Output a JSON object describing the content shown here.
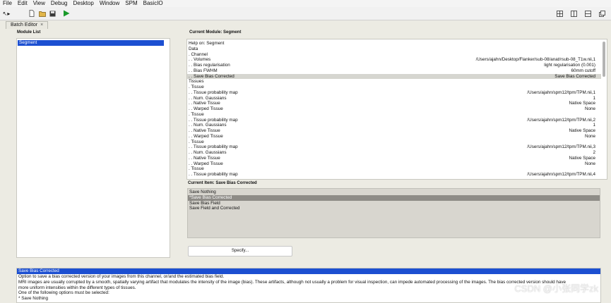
{
  "menubar": [
    "File",
    "Edit",
    "View",
    "Debug",
    "Desktop",
    "Window",
    "SPM",
    "BasicIO"
  ],
  "toolbar": {
    "undo_redo": "↖▸",
    "new_icon": "new-file-icon",
    "open_icon": "open-folder-icon",
    "save_icon": "save-icon",
    "run_icon": "run-icon"
  },
  "tab": {
    "label": "Batch Editor",
    "close": "×"
  },
  "module_list": {
    "heading": "Module List",
    "items": [
      "Segment"
    ]
  },
  "current_module": {
    "heading": "Current Module: Segment",
    "rows": [
      {
        "label": "Help on: Segment",
        "value": ""
      },
      {
        "label": "Data",
        "value": ""
      },
      {
        "label": ". Channel",
        "value": ""
      },
      {
        "label": ". . Volumes",
        "value": "/Users/ajahn/Desktop/Flanker/sub-08/anat/rsub-08_T1w.nii,1"
      },
      {
        "label": ". . Bias regularisation",
        "value": "light regularisation (0.001)"
      },
      {
        "label": ". . Bias FWHM",
        "value": "60mm cutoff"
      },
      {
        "label": ". . Save Bias Corrected",
        "value": "Save Bias Corrected"
      },
      {
        "label": "Tissues",
        "value": ""
      },
      {
        "label": ". Tissue",
        "value": ""
      },
      {
        "label": ". . Tissue probability map",
        "value": "/Users/ajahn/spm12/tpm/TPM.nii,1"
      },
      {
        "label": ". . Num. Gaussians",
        "value": "1"
      },
      {
        "label": ". . Native Tissue",
        "value": "Native Space"
      },
      {
        "label": ". . Warped Tissue",
        "value": "None"
      },
      {
        "label": ". Tissue",
        "value": ""
      },
      {
        "label": ". . Tissue probability map",
        "value": "/Users/ajahn/spm12/tpm/TPM.nii,2"
      },
      {
        "label": ". . Num. Gaussians",
        "value": "1"
      },
      {
        "label": ". . Native Tissue",
        "value": "Native Space"
      },
      {
        "label": ". . Warped Tissue",
        "value": "None"
      },
      {
        "label": ". Tissue",
        "value": ""
      },
      {
        "label": ". . Tissue probability map",
        "value": "/Users/ajahn/spm12/tpm/TPM.nii,3"
      },
      {
        "label": ". . Num. Gaussians",
        "value": "2"
      },
      {
        "label": ". . Native Tissue",
        "value": "Native Space"
      },
      {
        "label": ". . Warped Tissue",
        "value": "None"
      },
      {
        "label": ". Tissue",
        "value": ""
      },
      {
        "label": ". . Tissue probability map",
        "value": "/Users/ajahn/spm12/tpm/TPM.nii,4"
      }
    ],
    "selected_index": 6
  },
  "current_item": {
    "heading": "Current Item: Save Bias Corrected",
    "options": [
      "Save Nothing",
      "*Save Bias Corrected",
      "Save Bias Field",
      "Save Field and Corrected"
    ],
    "selected_index": 1
  },
  "specify_button": "Specify...",
  "help": {
    "title": "Save Bias Corrected",
    "lines": [
      "Option to save a bias corrected version of your images from this channel, or/and the estimated bias field.",
      "MRI  images  are usually corrupted by a smooth, spatially varying artifact that modulates the intensity of the image (bias). These artifacts, although not usually a problem for visual inspection, can impede automated processing of the images. The bias corrected version should have",
      "more uniform intensities within the different types of tissues.",
      "One of the following options must be selected:",
      "* Save Nothing"
    ]
  },
  "watermark": "CSDN @小张同学zk",
  "colors": {
    "selection_blue": "#1c4fd1",
    "run_green": "#1a9a2a"
  }
}
